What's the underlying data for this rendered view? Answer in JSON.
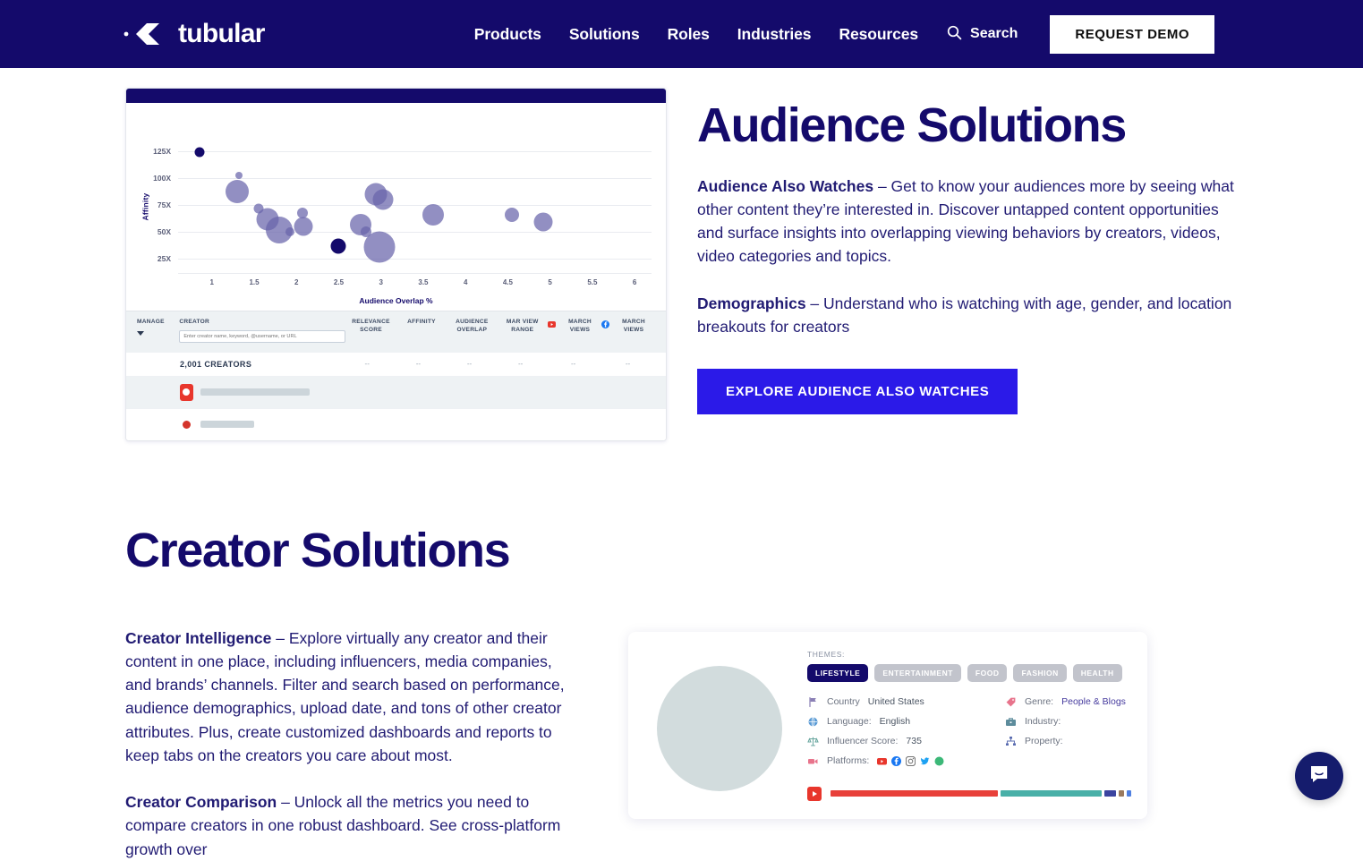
{
  "header": {
    "logo_text": "tubular",
    "logo_icon": "tubular-diamond-logo",
    "nav": [
      {
        "label": "Products"
      },
      {
        "label": "Solutions"
      },
      {
        "label": "Roles"
      },
      {
        "label": "Industries"
      },
      {
        "label": "Resources"
      }
    ],
    "search_label": "Search",
    "search_icon": "search-icon",
    "demo_button": "REQUEST DEMO",
    "bg_color": "#140a6b"
  },
  "audience": {
    "heading": "Audience Solutions",
    "paragraphs": [
      {
        "lead": "Audience Also Watches",
        "rest": " – Get to know your audiences more by seeing what other content they’re interested in. Discover untapped content opportunities and surface insights into overlapping viewing behaviors by creators, videos, video categories and topics."
      },
      {
        "lead": "Demographics",
        "rest": " – Understand who is watching with age, gender, and location breakouts for creators"
      }
    ],
    "cta_label": "EXPLORE AUDIENCE ALSO WATCHES",
    "cta_color": "#2b1ae8"
  },
  "dashboard": {
    "table": {
      "headers": [
        {
          "key": "manage",
          "label": "MANAGE",
          "icon": "filter-caret-icon"
        },
        {
          "key": "creator",
          "label": "CREATOR"
        },
        {
          "key": "relevance",
          "label": "RELEVANCE SCORE"
        },
        {
          "key": "affinity",
          "label": "AFFINITY"
        },
        {
          "key": "overlap",
          "label": "AUDIENCE OVERLAP"
        },
        {
          "key": "range",
          "label": "MAR VIEW RANGE"
        },
        {
          "key": "yt_views",
          "label": "MARCH VIEWS",
          "icon": "youtube-icon"
        },
        {
          "key": "fb_views",
          "label": "MARCH VIEWS",
          "icon": "facebook-icon"
        }
      ],
      "creator_search_placeholder": "Enter creator name, keyword, @username, or URL",
      "count_row_label": "2,001 CREATORS",
      "count_row_values": [
        "--",
        "--",
        "--",
        "--",
        "--",
        "--"
      ]
    }
  },
  "chart_data": {
    "type": "scatter",
    "title": "",
    "xlabel": "Audience Overlap %",
    "ylabel": "Affinity",
    "xlim": [
      0.6,
      6.2
    ],
    "ylim": [
      12,
      135
    ],
    "xticks": [
      "1",
      "1.5",
      "2",
      "2.5",
      "3",
      "3.5",
      "4",
      "4.5",
      "5",
      "5.5",
      "6"
    ],
    "xtick_values": [
      1,
      1.5,
      2,
      2.5,
      3,
      3.5,
      4,
      4.5,
      5,
      5.5,
      6
    ],
    "yticks": [
      "125X",
      "100X",
      "75X",
      "50X",
      "25X"
    ],
    "ytick_values": [
      125,
      100,
      75,
      50,
      25
    ],
    "grid": true,
    "legend": "none",
    "bubble_color": "#6864aa",
    "highlight_color": "#140a6b",
    "points": [
      {
        "x": 0.85,
        "y": 124,
        "size": 11,
        "highlight": true
      },
      {
        "x": 1.32,
        "y": 103,
        "size": 8,
        "highlight": false
      },
      {
        "x": 1.3,
        "y": 88,
        "size": 26,
        "highlight": false
      },
      {
        "x": 1.55,
        "y": 72,
        "size": 11,
        "highlight": false
      },
      {
        "x": 1.66,
        "y": 62,
        "size": 25,
        "highlight": false
      },
      {
        "x": 1.8,
        "y": 52,
        "size": 30,
        "highlight": false
      },
      {
        "x": 1.92,
        "y": 50,
        "size": 10,
        "highlight": false
      },
      {
        "x": 2.07,
        "y": 68,
        "size": 12,
        "highlight": false
      },
      {
        "x": 2.08,
        "y": 55,
        "size": 21,
        "highlight": false
      },
      {
        "x": 2.5,
        "y": 37,
        "size": 17,
        "highlight": true
      },
      {
        "x": 2.76,
        "y": 57,
        "size": 24,
        "highlight": false
      },
      {
        "x": 2.82,
        "y": 50,
        "size": 12,
        "highlight": false
      },
      {
        "x": 2.94,
        "y": 85,
        "size": 25,
        "highlight": false
      },
      {
        "x": 3.02,
        "y": 80,
        "size": 23,
        "highlight": false
      },
      {
        "x": 2.98,
        "y": 36,
        "size": 35,
        "highlight": false
      },
      {
        "x": 3.62,
        "y": 66,
        "size": 24,
        "highlight": false
      },
      {
        "x": 4.55,
        "y": 66,
        "size": 16,
        "highlight": false
      },
      {
        "x": 4.92,
        "y": 59,
        "size": 21,
        "highlight": false
      }
    ]
  },
  "creator": {
    "heading": "Creator Solutions",
    "paragraphs": [
      {
        "lead": "Creator Intelligence",
        "rest": " – Explore virtually any creator and their content in one place, including influencers, media companies, and brands’ channels. Filter and search based on performance, audience demographics, upload date, and tons of other creator attributes. Plus, create customized dashboards and reports to keep tabs on the creators you care about most."
      },
      {
        "lead": "Creator Comparison",
        "rest": " – Unlock all the metrics you need to compare creators in one robust dashboard. See cross-platform growth over"
      }
    ]
  },
  "profile_card": {
    "avatar_icon": "avatar-placeholder",
    "themes_label": "THEMES:",
    "themes": [
      {
        "label": "LIFESTYLE",
        "active": true
      },
      {
        "label": "ENTERTAINMENT",
        "active": false
      },
      {
        "label": "FOOD",
        "active": false
      },
      {
        "label": "FASHION",
        "active": false
      },
      {
        "label": "HEALTH",
        "active": false
      }
    ],
    "meta_left": [
      {
        "icon": "flag-icon",
        "label": "Country",
        "value": "United States"
      },
      {
        "icon": "globe-icon",
        "label": "Language:",
        "value": "English"
      },
      {
        "icon": "scales-icon",
        "label": "Influencer Score:",
        "value": "735"
      },
      {
        "icon": "video-camera-icon",
        "label": "Platforms:",
        "value": ""
      }
    ],
    "meta_right": [
      {
        "icon": "tag-icon",
        "label": "Genre:",
        "value": "People & Blogs",
        "link": true
      },
      {
        "icon": "briefcase-icon",
        "label": "Industry:",
        "value": ""
      },
      {
        "icon": "sitemap-icon",
        "label": "Property:",
        "value": ""
      }
    ],
    "platform_icons": [
      "youtube-icon",
      "facebook-icon",
      "instagram-icon",
      "twitter-icon",
      "twitch-icon"
    ],
    "views_bar": {
      "icon": "youtube-icon",
      "segments": [
        {
          "color": "#e8403a",
          "pct": 55
        },
        {
          "color": "#49b0a8",
          "pct": 33
        },
        {
          "color": "#3b44a0",
          "pct": 4
        },
        {
          "color": "#9a7a5e",
          "pct": 1.6
        },
        {
          "color": "#4f7fe0",
          "pct": 1.6
        }
      ]
    }
  },
  "chat": {
    "icon": "chat-bubble-icon"
  }
}
